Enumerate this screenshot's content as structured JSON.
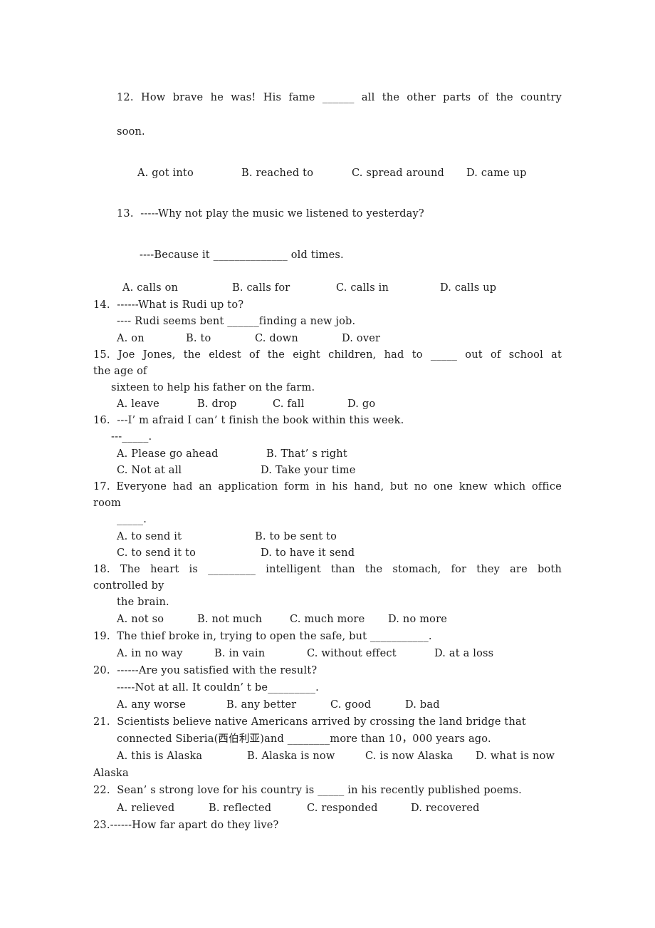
{
  "document": {
    "questions": [
      {
        "number": "12",
        "lines": [
          "12.  How brave he was! His fame ______ all the other parts of the country",
          "soon."
        ],
        "options": [
          "A. got into",
          "B. reached to",
          "C. spread around",
          "D. came up"
        ]
      },
      {
        "number": "13",
        "lines": [
          "13.  -----Why not play the music we listened to yesterday?",
          "----Because it ______________ old times."
        ],
        "options": [
          "A. calls on",
          "B. calls for",
          "C. calls in",
          "D. calls up"
        ]
      },
      {
        "number": "14",
        "lines": [
          "14.  ------What is Rudi up to?",
          "---- Rudi seems bent ______finding a new job."
        ],
        "options": [
          "A. on",
          "B. to",
          "C. down",
          "D. over"
        ]
      },
      {
        "number": "15",
        "lines": [
          "15.  Joe Jones, the eldest of the eight children, had to _____ out of school at",
          "the age of",
          "sixteen to help his father on the farm."
        ],
        "options": [
          "A. leave",
          "B. drop",
          "C. fall",
          "D. go"
        ]
      },
      {
        "number": "16",
        "lines": [
          "16.  ---I’ m afraid I can’ t finish the book within this week.",
          "---_____."
        ],
        "options": [
          "A. Please go ahead",
          "B. That’ s right",
          "C. Not at all",
          "D. Take your time"
        ]
      },
      {
        "number": "17",
        "lines": [
          "17.  Everyone had an application form in his hand, but no one knew which office",
          "room",
          "_____."
        ],
        "options": [
          "A. to send it",
          "B. to be sent to",
          "C. to send it to",
          "D. to have it send"
        ]
      },
      {
        "number": "18",
        "lines": [
          "18.  The heart is _________ intelligent than the stomach, for they are both",
          "controlled by",
          "the brain."
        ],
        "options": [
          "A. not so",
          "B. not much",
          "C. much more",
          "D. no more"
        ]
      },
      {
        "number": "19",
        "lines": [
          "19.  The thief broke in, trying to open the safe, but ___________."
        ],
        "options": [
          "A. in no way",
          "B. in vain",
          "C. without effect",
          "D. at a loss"
        ]
      },
      {
        "number": "20",
        "lines": [
          "20.  ------Are you satisfied with the result?",
          "-----Not at all. It couldn’ t be_________."
        ],
        "options": [
          "A. any worse",
          "B. any better",
          "C. good",
          "D. bad"
        ]
      },
      {
        "number": "21",
        "lines": [
          "21.  Scientists believe native Americans arrived by crossing the land bridge that",
          "connected Siberia(西伯利亚)and ________more than 10，000 years ago."
        ],
        "options": [
          "A. this is Alaska",
          "B. Alaska is now",
          "C. is now Alaska",
          "D. what is now",
          "Alaska"
        ]
      },
      {
        "number": "22",
        "lines": [
          "22.  Sean’ s strong love for his country is _____ in his recently published poems."
        ],
        "options": [
          "A. relieved",
          "B. reflected",
          "C. responded",
          "D. recovered"
        ]
      },
      {
        "number": "23",
        "lines": [
          "23.------How far apart do they live?"
        ],
        "options": []
      }
    ]
  }
}
